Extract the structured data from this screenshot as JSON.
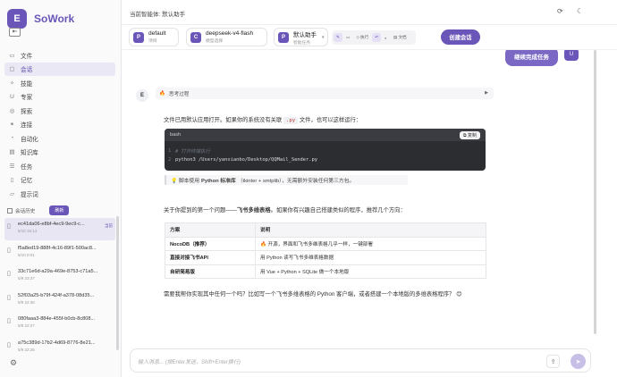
{
  "brand": {
    "logo_letter": "E",
    "name": "SoWork",
    "collapse_icon": "⇤"
  },
  "nav": [
    {
      "icon": "folder-icon",
      "glyph": "▭",
      "label": "文件"
    },
    {
      "icon": "chat-icon",
      "glyph": "▢",
      "label": "会话"
    },
    {
      "icon": "sparkle-icon",
      "glyph": "✧",
      "label": "技能"
    },
    {
      "icon": "user-icon",
      "glyph": "U",
      "label": "专家"
    },
    {
      "icon": "compass-icon",
      "glyph": "◎",
      "label": "探索"
    },
    {
      "icon": "link-icon",
      "glyph": "⚭",
      "label": "连接"
    },
    {
      "icon": "automation-icon",
      "glyph": "◔",
      "label": "自动化"
    },
    {
      "icon": "book-icon",
      "glyph": "▤",
      "label": "知识库"
    },
    {
      "icon": "task-icon",
      "glyph": "☰",
      "label": "任务"
    },
    {
      "icon": "memory-icon",
      "glyph": "▯",
      "label": "记忆"
    },
    {
      "icon": "feedback-icon",
      "glyph": "▱",
      "label": "提示词"
    }
  ],
  "history": {
    "label": "会话历史",
    "button": "刷新"
  },
  "sessions": [
    {
      "id": "ec41da06-e8bf-4ec9-9ec9-c...",
      "date": "5/10 16:14",
      "current": "当前"
    },
    {
      "id": "f5a8ed19-888f-4c16-89f1-500ac8...",
      "date": "5/10 0:01",
      "current": ""
    },
    {
      "id": "33c71e6d-a29a-469e-8753-c71a5...",
      "date": "5/9 23:37",
      "current": ""
    },
    {
      "id": "52f03a25-b79f-424f-a378-08d35...",
      "date": "5/9 22:36",
      "current": ""
    },
    {
      "id": "080faaa3-884e-455f-b0cb-8c808...",
      "date": "5/9 22:27",
      "current": ""
    },
    {
      "id": "a75c389d-17b2-4d69-8776-8e21...",
      "date": "5/9 22:26",
      "current": ""
    }
  ],
  "header": {
    "title": "当前智能体: 默认助手"
  },
  "toolbar": {
    "project": {
      "badge": "P",
      "value": "default",
      "sub": "项目"
    },
    "model": {
      "badge": "C",
      "value": "deepseek-v4-flash",
      "sub": "模型选择"
    },
    "assistant": {
      "badge": "P",
      "value": "默认助手",
      "sub": "智能任务"
    },
    "tools": [
      "✎",
      "▭",
      "◇ 执行",
      "↶",
      "◐",
      "▤ 文档"
    ],
    "new_chat": "创建会话"
  },
  "chat": {
    "user_message": "继续完成任务",
    "user_avatar": "U",
    "assistant_avatar": "E",
    "thinking": "思考过程",
    "para1_a": "文件已用默认应用打开。如果你的系统没有关联 ",
    "para1_code": ".py",
    "para1_b": " 文件，也可以这样运行：",
    "code_lang": "bash",
    "copy": "复制",
    "code_comment": "# 打开终端执行",
    "code_line": "python3 /Users/yanxianbo/Desktop/QQMail_Sender.py",
    "tip_a": "💡 脚本使用",
    "tip_b": "Python 标准库",
    "tip_c": "（tkinter + smtplib），无需额外安装任何第三方包。",
    "para2_a": "关于你提到的第一个问题——",
    "para2_b": "飞书多维表格",
    "para2_c": "。如果你有兴趣自己搭建类似的程序，推荐几个方向：",
    "table_headers": [
      "方案",
      "说明"
    ],
    "table_rows": [
      [
        "NocoDB（推荐）",
        "🔥 开源，界面和飞书多维表格几乎一样，一键部署"
      ],
      [
        "直接对接飞书API",
        "用 Python 读写飞书多维表格数据"
      ],
      [
        "自研简易版",
        "用 Vue + Python + SQLite 做一个本地版"
      ]
    ],
    "para3": "需要我帮你实现其中任何一个吗？比如写一个飞书多维表格的 Python 客户端，或者搭建一个本地版的多维表格程序？ 😊"
  },
  "input": {
    "placeholder": "输入消息... (按Enter发送，Shift+Enter换行)"
  }
}
